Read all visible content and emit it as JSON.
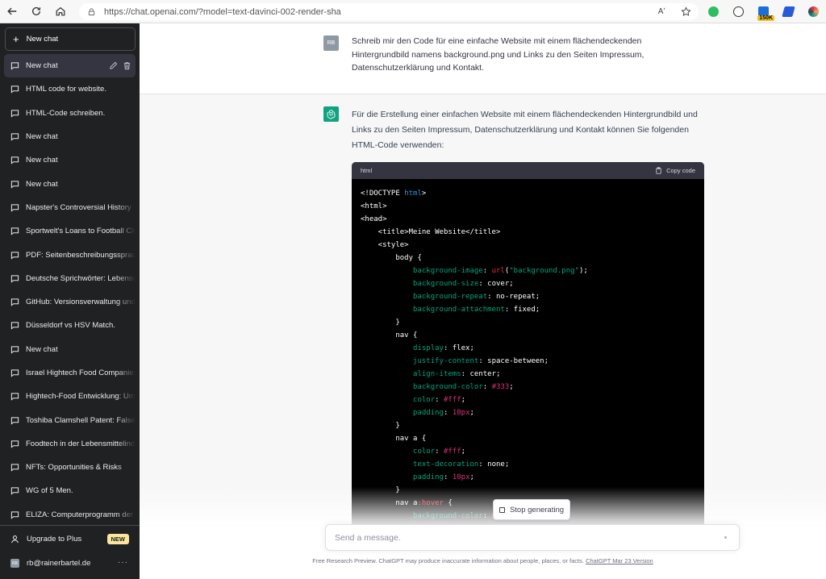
{
  "browser": {
    "url": "https://chat.openai.com/?model=text-davinci-002-render-sha",
    "read_aloud_label": "Aʹ",
    "extension_badge": "150K"
  },
  "sidebar": {
    "new_chat_label": "New chat",
    "items": [
      {
        "label": "New chat"
      },
      {
        "label": "HTML code for website."
      },
      {
        "label": "HTML-Code schreiben."
      },
      {
        "label": "New chat"
      },
      {
        "label": "New chat"
      },
      {
        "label": "New chat"
      },
      {
        "label": "Napster's Controversial History"
      },
      {
        "label": "Sportwelt's Loans to Football Clubs"
      },
      {
        "label": "PDF: Seitenbeschreibungssprache"
      },
      {
        "label": "Deutsche Sprichwörter: Lebensweisheiten"
      },
      {
        "label": "GitHub: Versionsverwaltung und"
      },
      {
        "label": "Düsseldorf vs HSV Match."
      },
      {
        "label": "New chat"
      },
      {
        "label": "Israel Hightech Food Companies"
      },
      {
        "label": "Hightech-Food Entwicklung: Umwelt"
      },
      {
        "label": "Toshiba Clamshell Patent: False"
      },
      {
        "label": "Foodtech in der Lebensmittelindustrie"
      },
      {
        "label": "NFTs: Opportunities & Risks"
      },
      {
        "label": "WG of 5 Men."
      },
      {
        "label": "ELIZA: Computerprogramm der"
      }
    ],
    "upgrade_label": "Upgrade to Plus",
    "upgrade_badge": "NEW",
    "account_initials": "RB",
    "account_email": "rb@rainerbartel.de",
    "more_label": "···"
  },
  "conversation": {
    "user_initials": "RB",
    "user_message": "Schreib mir den Code für eine einfache Website mit einem flächendeckenden Hintergrundbild namens background.png und Links zu den Seiten Impressum, Datenschutzerklärung und Kontakt.",
    "assistant_intro": "Für die Erstellung einer einfachen Website mit einem flächendeckenden Hintergrundbild und Links zu den Seiten Impressum, Datenschutzerklärung und Kontakt können Sie folgenden HTML-Code verwenden:",
    "code_language": "html",
    "copy_code_label": "Copy code",
    "code_lines": [
      [
        {
          "t": "<!DOCTYPE ",
          "c": "plain"
        },
        {
          "t": "html",
          "c": "kw"
        },
        {
          "t": ">",
          "c": "plain"
        }
      ],
      [
        {
          "t": "<html>",
          "c": "plain"
        }
      ],
      [
        {
          "t": "<head>",
          "c": "plain"
        }
      ],
      [
        {
          "t": "    <title>Meine Website</title>",
          "c": "plain"
        }
      ],
      [
        {
          "t": "    <style>",
          "c": "plain"
        }
      ],
      [
        {
          "t": "        body {",
          "c": "plain"
        }
      ],
      [
        {
          "t": "            ",
          "c": "plain"
        },
        {
          "t": "background-image",
          "c": "prop"
        },
        {
          "t": ": ",
          "c": "plain"
        },
        {
          "t": "url",
          "c": "fn"
        },
        {
          "t": "(",
          "c": "plain"
        },
        {
          "t": "\"background.png\"",
          "c": "str"
        },
        {
          "t": ");",
          "c": "plain"
        }
      ],
      [
        {
          "t": "            ",
          "c": "plain"
        },
        {
          "t": "background-size",
          "c": "prop"
        },
        {
          "t": ": cover;",
          "c": "plain"
        }
      ],
      [
        {
          "t": "            ",
          "c": "plain"
        },
        {
          "t": "background-repeat",
          "c": "prop"
        },
        {
          "t": ": no-repeat;",
          "c": "plain"
        }
      ],
      [
        {
          "t": "            ",
          "c": "plain"
        },
        {
          "t": "background-attachment",
          "c": "prop"
        },
        {
          "t": ": fixed;",
          "c": "plain"
        }
      ],
      [
        {
          "t": "        }",
          "c": "plain"
        }
      ],
      [
        {
          "t": "        nav {",
          "c": "plain"
        }
      ],
      [
        {
          "t": "            ",
          "c": "plain"
        },
        {
          "t": "display",
          "c": "prop"
        },
        {
          "t": ": flex;",
          "c": "plain"
        }
      ],
      [
        {
          "t": "            ",
          "c": "plain"
        },
        {
          "t": "justify-content",
          "c": "prop"
        },
        {
          "t": ": space-between;",
          "c": "plain"
        }
      ],
      [
        {
          "t": "            ",
          "c": "plain"
        },
        {
          "t": "align-items",
          "c": "prop"
        },
        {
          "t": ": center;",
          "c": "plain"
        }
      ],
      [
        {
          "t": "            ",
          "c": "plain"
        },
        {
          "t": "background-color",
          "c": "prop"
        },
        {
          "t": ": ",
          "c": "plain"
        },
        {
          "t": "#333",
          "c": "num"
        },
        {
          "t": ";",
          "c": "plain"
        }
      ],
      [
        {
          "t": "            ",
          "c": "plain"
        },
        {
          "t": "color",
          "c": "prop"
        },
        {
          "t": ": ",
          "c": "plain"
        },
        {
          "t": "#fff",
          "c": "num"
        },
        {
          "t": ";",
          "c": "plain"
        }
      ],
      [
        {
          "t": "            ",
          "c": "plain"
        },
        {
          "t": "padding",
          "c": "prop"
        },
        {
          "t": ": ",
          "c": "plain"
        },
        {
          "t": "10px",
          "c": "num"
        },
        {
          "t": ";",
          "c": "plain"
        }
      ],
      [
        {
          "t": "        }",
          "c": "plain"
        }
      ],
      [
        {
          "t": "        nav a {",
          "c": "plain"
        }
      ],
      [
        {
          "t": "            ",
          "c": "plain"
        },
        {
          "t": "color",
          "c": "prop"
        },
        {
          "t": ": ",
          "c": "plain"
        },
        {
          "t": "#fff",
          "c": "num"
        },
        {
          "t": ";",
          "c": "plain"
        }
      ],
      [
        {
          "t": "            ",
          "c": "plain"
        },
        {
          "t": "text-decoration",
          "c": "prop"
        },
        {
          "t": ": none;",
          "c": "plain"
        }
      ],
      [
        {
          "t": "            ",
          "c": "plain"
        },
        {
          "t": "padding",
          "c": "prop"
        },
        {
          "t": ": ",
          "c": "plain"
        },
        {
          "t": "10px",
          "c": "num"
        },
        {
          "t": ";",
          "c": "plain"
        }
      ],
      [
        {
          "t": "        }",
          "c": "plain"
        }
      ],
      [
        {
          "t": "        nav a",
          "c": "plain"
        },
        {
          "t": ":hover",
          "c": "fn"
        },
        {
          "t": " {",
          "c": "plain"
        }
      ],
      [
        {
          "t": "            ",
          "c": "plain"
        },
        {
          "t": "background-color",
          "c": "prop"
        },
        {
          "t": ": ",
          "c": "plain"
        },
        {
          "t": "#fff",
          "c": "num"
        },
        {
          "t": ";",
          "c": "plain"
        }
      ]
    ],
    "stop_label": "Stop generating",
    "input_placeholder": "Send a message.",
    "footer_text": "Free Research Preview. ChatGPT may produce inaccurate information about people, places, or facts. ",
    "footer_link": "ChatGPT Mar 23 Version"
  },
  "colors": {
    "sidebar_bg": "#202123",
    "assistant_bg": "#f7f7f8",
    "gpt_green": "#10a37f",
    "code_bg": "#000000",
    "new_badge": "#fae69e"
  },
  "icons": {
    "back": "arrow-left-icon",
    "reload": "reload-icon",
    "home": "home-icon",
    "lock": "lock-icon",
    "chat": "chat-bubble-icon",
    "edit": "pencil-icon",
    "delete": "trash-icon",
    "user": "user-icon",
    "copy": "clipboard-icon",
    "gpt": "openai-logo-icon"
  }
}
